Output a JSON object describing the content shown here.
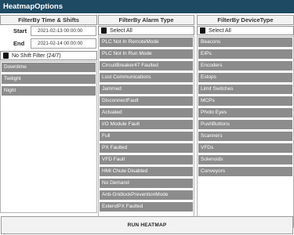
{
  "title": "HeatmapOptions",
  "time_panel": {
    "header": "FilterBy Time & Shifts",
    "start_label": "Start",
    "start_value": "2021-02-13 00:00:00",
    "end_label": "End",
    "end_value": "2021-02-14 00:00:00",
    "no_shift_label": "No Shift Filter (24/7)",
    "shifts": [
      "Downtime",
      "Twilight",
      "Night"
    ]
  },
  "alarm_panel": {
    "header": "FilterBy Alarm Type",
    "select_all": "Select All",
    "items": [
      "PLC Not In RemoteMode",
      "PLC Not In Run Mode",
      "CircuitBreaker47 Faulted",
      "Lost Communications",
      "Jammed",
      "DisconnectFault",
      "Actuated",
      "I/O Module Fault",
      "Full",
      "PX Faulted",
      "VFD Fault",
      "HMI Chute Disabled",
      "No Demand",
      "Anti-GridlockPreventionMode",
      "ExtendPX Faulted"
    ]
  },
  "device_panel": {
    "header": "FilterBy DeviceType",
    "select_all": "Select All",
    "items": [
      "Beacons",
      "EIPs",
      "Encoders",
      "Estops",
      "Limit Switches",
      "MCPs",
      "Photo Eyes",
      "PushButtons",
      "Scanners",
      "VFDs",
      "Solenoids",
      "Conveyors"
    ]
  },
  "run_button": "RUN HEATMAP"
}
